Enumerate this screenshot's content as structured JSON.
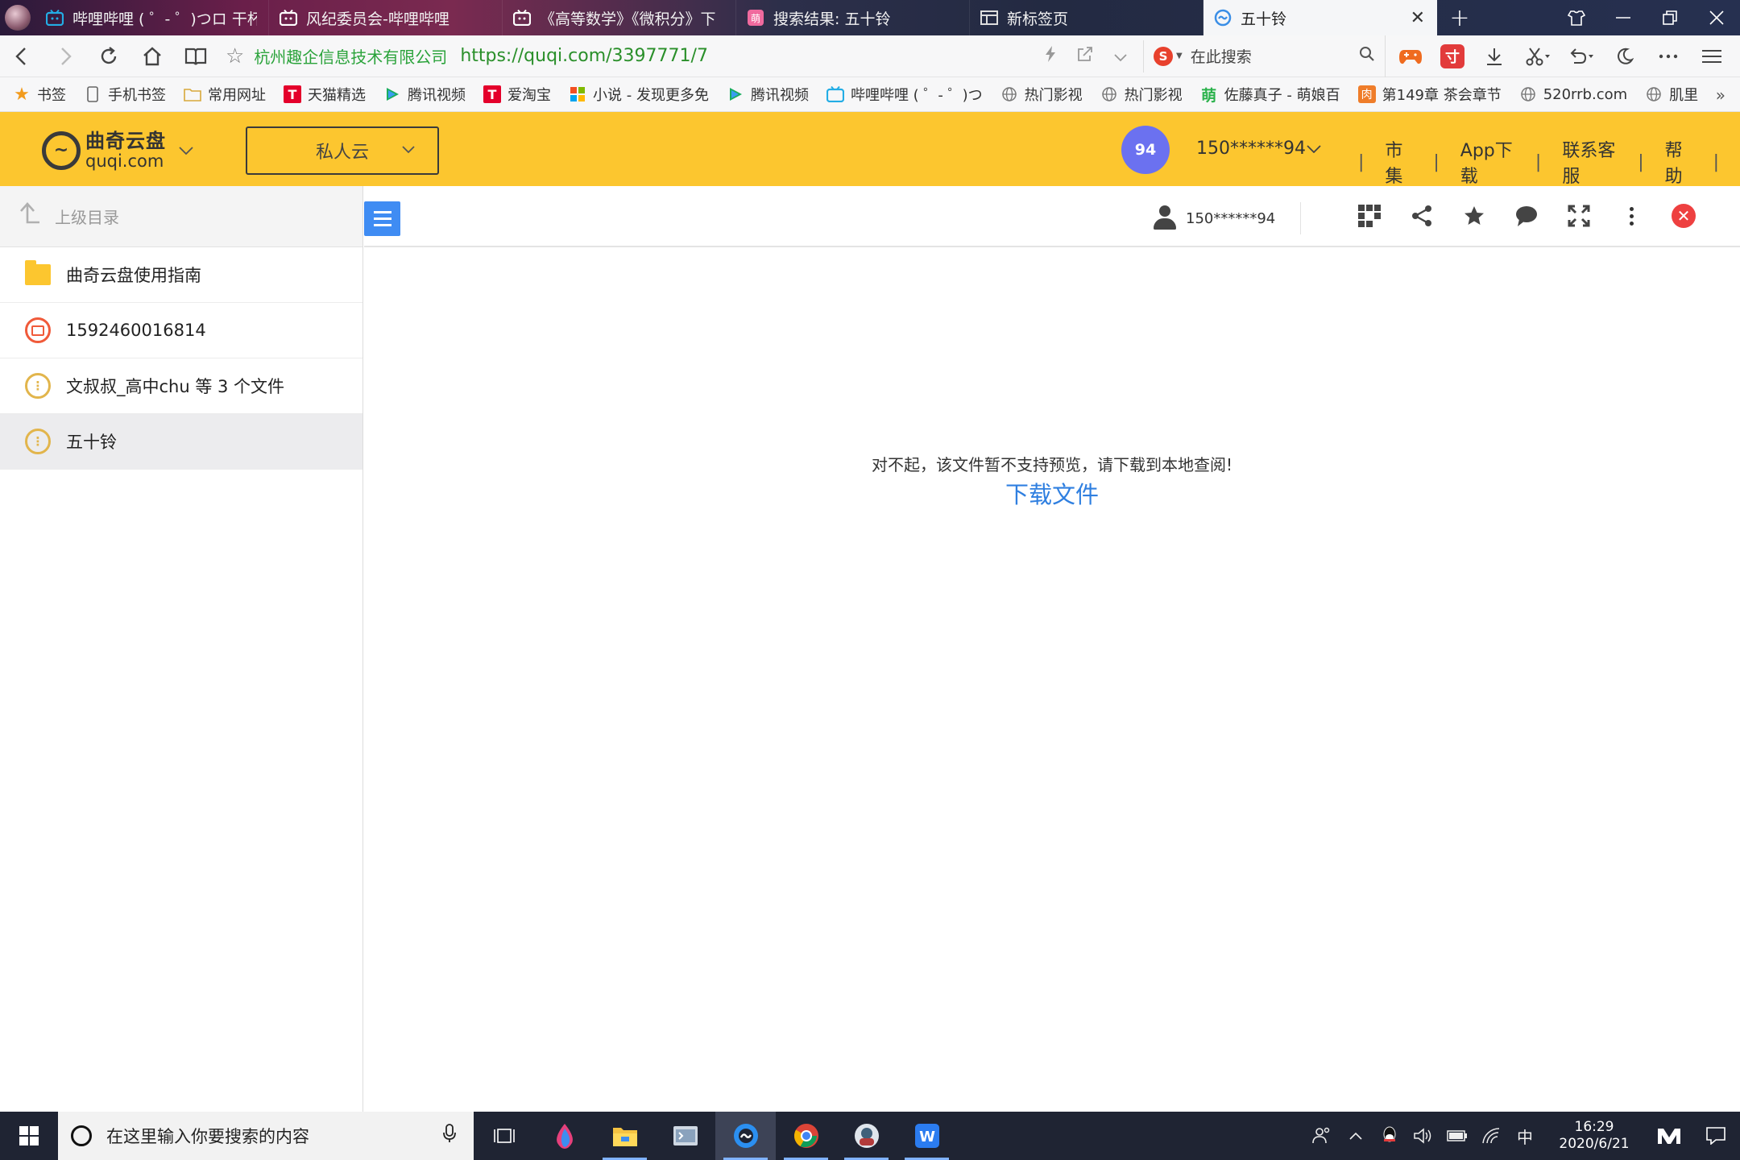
{
  "browser": {
    "tabs": [
      {
        "title": "哔哩哔哩 ( ゜- ゜)つロ 干杯~",
        "icon": "bilibili-icon"
      },
      {
        "title": "风纪委员会-哔哩哔哩",
        "icon": "bilibili-icon"
      },
      {
        "title": "《高等数学》《微积分》下",
        "icon": "bilibili-icon"
      },
      {
        "title": "搜索结果: 五十铃",
        "icon": "search-result-icon"
      },
      {
        "title": "新标签页",
        "icon": "newtab-icon"
      },
      {
        "title": "五十铃",
        "icon": "quqi-icon"
      }
    ],
    "active_tab_close": "✕",
    "new_tab": "+",
    "address": {
      "org": "杭州趣企信息技术有限公司",
      "url": "https://quqi.com/3397771/7",
      "search_placeholder": "在此搜索"
    },
    "bookmarks": [
      {
        "label": "书签",
        "icon": "star-icon"
      },
      {
        "label": "手机书签",
        "icon": "phone-icon"
      },
      {
        "label": "常用网址",
        "icon": "folder-icon"
      },
      {
        "label": "天猫精选",
        "icon": "tmall-icon"
      },
      {
        "label": "腾讯视频",
        "icon": "tencent-video-icon"
      },
      {
        "label": "爱淘宝",
        "icon": "taobao-icon"
      },
      {
        "label": "小说 - 发现更多免",
        "icon": "windows-icon"
      },
      {
        "label": "腾讯视频",
        "icon": "tencent-video-icon"
      },
      {
        "label": "哔哩哔哩 ( ゜- ゜)つ",
        "icon": "bilibili-icon"
      },
      {
        "label": "热门影视",
        "icon": "globe-icon"
      },
      {
        "label": "热门影视",
        "icon": "globe-icon"
      },
      {
        "label": "佐藤真子 - 萌娘百",
        "icon": "moegirl-icon"
      },
      {
        "label": "第149章 茶会章节",
        "icon": "book-icon"
      },
      {
        "label": "520rrb.com",
        "icon": "globe-icon"
      },
      {
        "label": "肌里",
        "icon": "globe-icon"
      }
    ],
    "bookmarks_more": "»"
  },
  "site": {
    "logo_cn": "曲奇云盘",
    "logo_en": "quqi.com",
    "space_select": "私人云",
    "user_badge": "94",
    "user_name": "150******94",
    "links": [
      "市集",
      "App下载",
      "联系客服",
      "帮助"
    ],
    "accent_color": "#fcc62f"
  },
  "sidebar": {
    "parent_dir": "上级目录",
    "items": [
      {
        "name": "曲奇云盘使用指南",
        "type": "folder"
      },
      {
        "name": "1592460016814",
        "type": "image"
      },
      {
        "name": "文叔叔_高中chu 等 3 个文件",
        "type": "archive"
      },
      {
        "name": "五十铃",
        "type": "archive",
        "selected": true
      }
    ]
  },
  "viewer": {
    "owner": "150******94",
    "message": "对不起，该文件暂不支持预览，请下载到本地查阅!",
    "download_label": "下载文件"
  },
  "taskbar": {
    "search_placeholder": "在这里输入你要搜索的内容",
    "ime": "中",
    "time": "16:29",
    "date": "2020/6/21"
  }
}
